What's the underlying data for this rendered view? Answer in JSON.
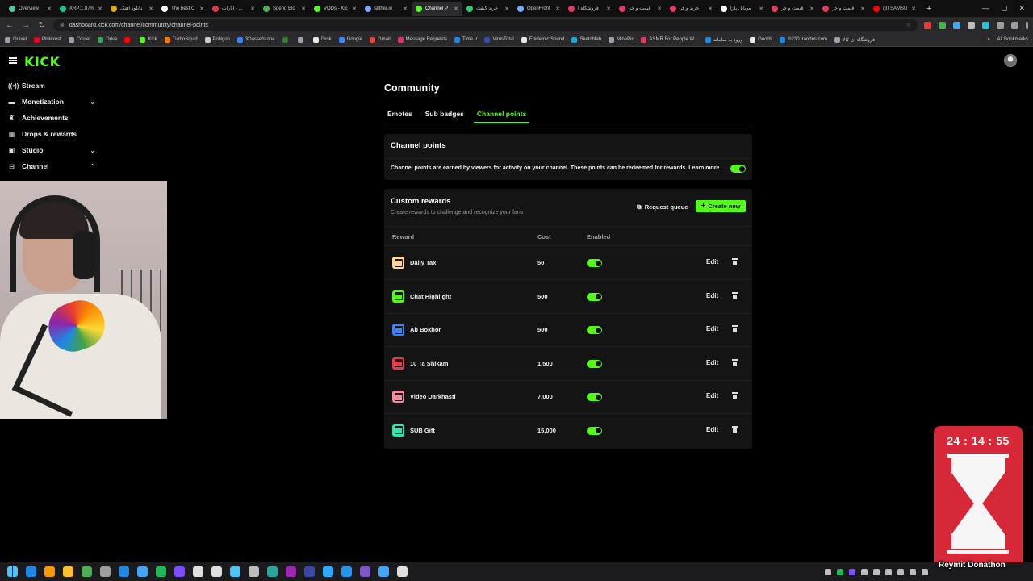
{
  "browser": {
    "tabs": [
      {
        "label": "Overview",
        "color": "#53c3a5"
      },
      {
        "label": "XRP:1.87%",
        "color": "#16c784"
      },
      {
        "label": "دانلود آهنگ",
        "color": "#e0a800"
      },
      {
        "label": "The best C",
        "color": "#ffffff"
      },
      {
        "label": "آپارات - ...",
        "color": "#e2364a"
      },
      {
        "label": "Spend Elo",
        "color": "#4caf50"
      },
      {
        "label": "VODs - Kic",
        "color": "#53fc18"
      },
      {
        "label": "slither.io",
        "color": "#7aa7ff"
      },
      {
        "label": "Channel P",
        "color": "#53fc18",
        "active": true
      },
      {
        "label": "خرید گیفت",
        "color": "#2ecc71"
      },
      {
        "label": "OpenFront",
        "color": "#6fb1ff"
      },
      {
        "label": "فروشگاه آ",
        "color": "#e53960"
      },
      {
        "label": "قیمت و خر",
        "color": "#e53960"
      },
      {
        "label": "خرید و فر",
        "color": "#e53960"
      },
      {
        "label": "موبایل پارا",
        "color": "#ffffff"
      },
      {
        "label": "قیمت و خر",
        "color": "#e53960"
      },
      {
        "label": "قیمت و خر",
        "color": "#e53960"
      },
      {
        "label": "(3) SAMSU",
        "color": "#ff0000"
      }
    ],
    "new_tab": "+",
    "window_controls": [
      "—",
      "▢",
      "✕"
    ],
    "address": "dashboard.kick.com/channel/community/channel-points",
    "bookmarks": [
      {
        "label": "Quixel",
        "color": "#9aa0a6"
      },
      {
        "label": "Pinterest",
        "color": "#e60023"
      },
      {
        "label": "Cooler",
        "color": "#9aa0a6"
      },
      {
        "label": "Drive",
        "color": "#34a853"
      },
      {
        "label": "",
        "color": "#ff0000"
      },
      {
        "label": "Kick",
        "color": "#53fc18"
      },
      {
        "label": "TurboSquid",
        "color": "#ff7a00"
      },
      {
        "label": "Poliigon",
        "color": "#cccccc"
      },
      {
        "label": "3Dassets.one",
        "color": "#3b82f6"
      },
      {
        "label": "",
        "color": "#2e7d32"
      },
      {
        "label": "",
        "color": "#9aa0a6"
      },
      {
        "label": "Grok",
        "color": "#e8e8e8"
      },
      {
        "label": "Google",
        "color": "#4285f4"
      },
      {
        "label": "Gmail",
        "color": "#ea4335"
      },
      {
        "label": "Message Requests",
        "color": "#e1306c"
      },
      {
        "label": "Time.Ir",
        "color": "#1e88e5"
      },
      {
        "label": "VirusTotal",
        "color": "#3949ab"
      },
      {
        "label": "Epidemic Sound",
        "color": "#e8e8e8"
      },
      {
        "label": "Sketchfab",
        "color": "#1caad9"
      },
      {
        "label": "MinePic",
        "color": "#9aa0a6"
      },
      {
        "label": "ASMR For People W...",
        "color": "#e53960"
      },
      {
        "label": "ورود به سامانه",
        "color": "#1e88e5"
      },
      {
        "label": "Goods",
        "color": "#e8e8e8"
      },
      {
        "label": "lh230.irandns.com",
        "color": "#1e88e5"
      },
      {
        "label": "فروشگاه ای کالا",
        "color": "#9aa0a6"
      }
    ],
    "bookmarks_more": "»",
    "all_bookmarks": "All Bookmarks"
  },
  "app": {
    "logo": "KICK"
  },
  "sidebar": {
    "items": [
      {
        "label": "Stream",
        "icon": "broadcast-icon",
        "glyph": "((•))",
        "chevron": ""
      },
      {
        "label": "Monetization",
        "icon": "wallet-icon",
        "glyph": "▬",
        "chevron": "⌄"
      },
      {
        "label": "Achievements",
        "icon": "trophy-icon",
        "glyph": "♜",
        "chevron": ""
      },
      {
        "label": "Drops & rewards",
        "icon": "gift-icon",
        "glyph": "▦",
        "chevron": ""
      },
      {
        "label": "Studio",
        "icon": "camera-icon",
        "glyph": "▣",
        "chevron": "⌄"
      },
      {
        "label": "Channel",
        "icon": "channel-icon",
        "glyph": "⊟",
        "chevron": "⌃"
      }
    ]
  },
  "main": {
    "title": "Community",
    "tabs": [
      {
        "label": "Emotes"
      },
      {
        "label": "Sub badges"
      },
      {
        "label": "Channel points",
        "active": true
      }
    ],
    "channel_points": {
      "title": "Channel points",
      "description": "Channel points are earned by viewers for activity on your channel. These points can be redeemed for rewards.",
      "learn_more": "Learn more",
      "enabled": true
    },
    "custom_rewards": {
      "title": "Custom rewards",
      "subtitle": "Create rewards to challenge and recognize your fans",
      "request_queue": "Request queue",
      "create_new": "Create new",
      "columns": {
        "reward": "Reward",
        "cost": "Cost",
        "enabled": "Enabled"
      },
      "rows": [
        {
          "name": "Daily Tax",
          "cost": "50",
          "enabled": true,
          "color": "#ffd59a",
          "edit": "Edit"
        },
        {
          "name": "Chat Highlight",
          "cost": "500",
          "enabled": true,
          "color": "#53fc18",
          "edit": "Edit"
        },
        {
          "name": "Ab Bokhor",
          "cost": "500",
          "enabled": true,
          "color": "#3b82f6",
          "edit": "Edit"
        },
        {
          "name": "10 Ta Shikam",
          "cost": "1,500",
          "enabled": true,
          "color": "#e53950",
          "edit": "Edit"
        },
        {
          "name": "Video Darkhasti",
          "cost": "7,000",
          "enabled": true,
          "color": "#f48aa0",
          "edit": "Edit"
        },
        {
          "name": "SUB Gift",
          "cost": "15,000",
          "enabled": true,
          "color": "#2ee6b0",
          "edit": "Edit"
        }
      ]
    }
  },
  "overlay": {
    "timer": "24 : 14 : 55",
    "label": "Reymit Donathon",
    "color": "#d62839"
  },
  "taskbar": {
    "apps": [
      "#1e88e5",
      "#ff9800",
      "#fbc02d",
      "#4caf50",
      "#9e9e9e",
      "#1e88e5",
      "#42a5f5",
      "#1db954",
      "#7c4dff",
      "#e0e0e0",
      "#e0e0e0",
      "#4fc3f7",
      "#bdbdbd",
      "#26a69a",
      "#9c27b0",
      "#3949ab",
      "#31a8ff",
      "#2196f3",
      "#7e57c2",
      "#42a5f5",
      "#e0e0e0"
    ],
    "tray": [
      "#bdbdbd",
      "#1db954",
      "#7c4dff",
      "#bdbdbd",
      "#bdbdbd",
      "#bdbdbd",
      "#bdbdbd",
      "#bdbdbd",
      "#bdbdbd"
    ]
  }
}
